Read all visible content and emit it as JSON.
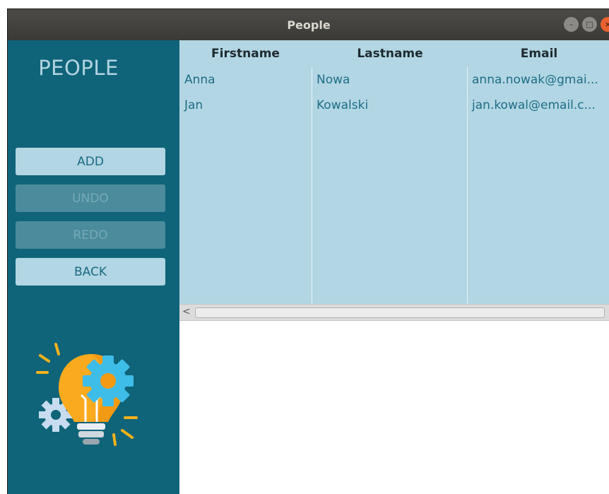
{
  "window": {
    "title": "People",
    "controls": [
      "minimize-icon",
      "maximize-icon",
      "close-icon"
    ]
  },
  "sidebar": {
    "heading": "PEOPLE",
    "buttons": {
      "add": "ADD",
      "undo": "UNDO",
      "redo": "REDO",
      "back": "BACK"
    },
    "illustration": "lightbulb-gears-icon"
  },
  "table": {
    "headers": {
      "firstname": "Firstname",
      "lastname": "Lastname",
      "email": "Email"
    },
    "rows": [
      {
        "firstname": "Anna",
        "lastname": "Nowa",
        "email": "anna.nowak@gmai..."
      },
      {
        "firstname": "Jan",
        "lastname": "Kowalski",
        "email": "jan.kowal@email.c..."
      }
    ]
  },
  "colors": {
    "titlebar": "#3b3a37",
    "sidebar": "#0f6479",
    "button_enabled": "#b2d6e3",
    "button_disabled": "#4b8b9b",
    "table_bg": "#b2d6e3",
    "text_accent": "#1e6e86"
  }
}
